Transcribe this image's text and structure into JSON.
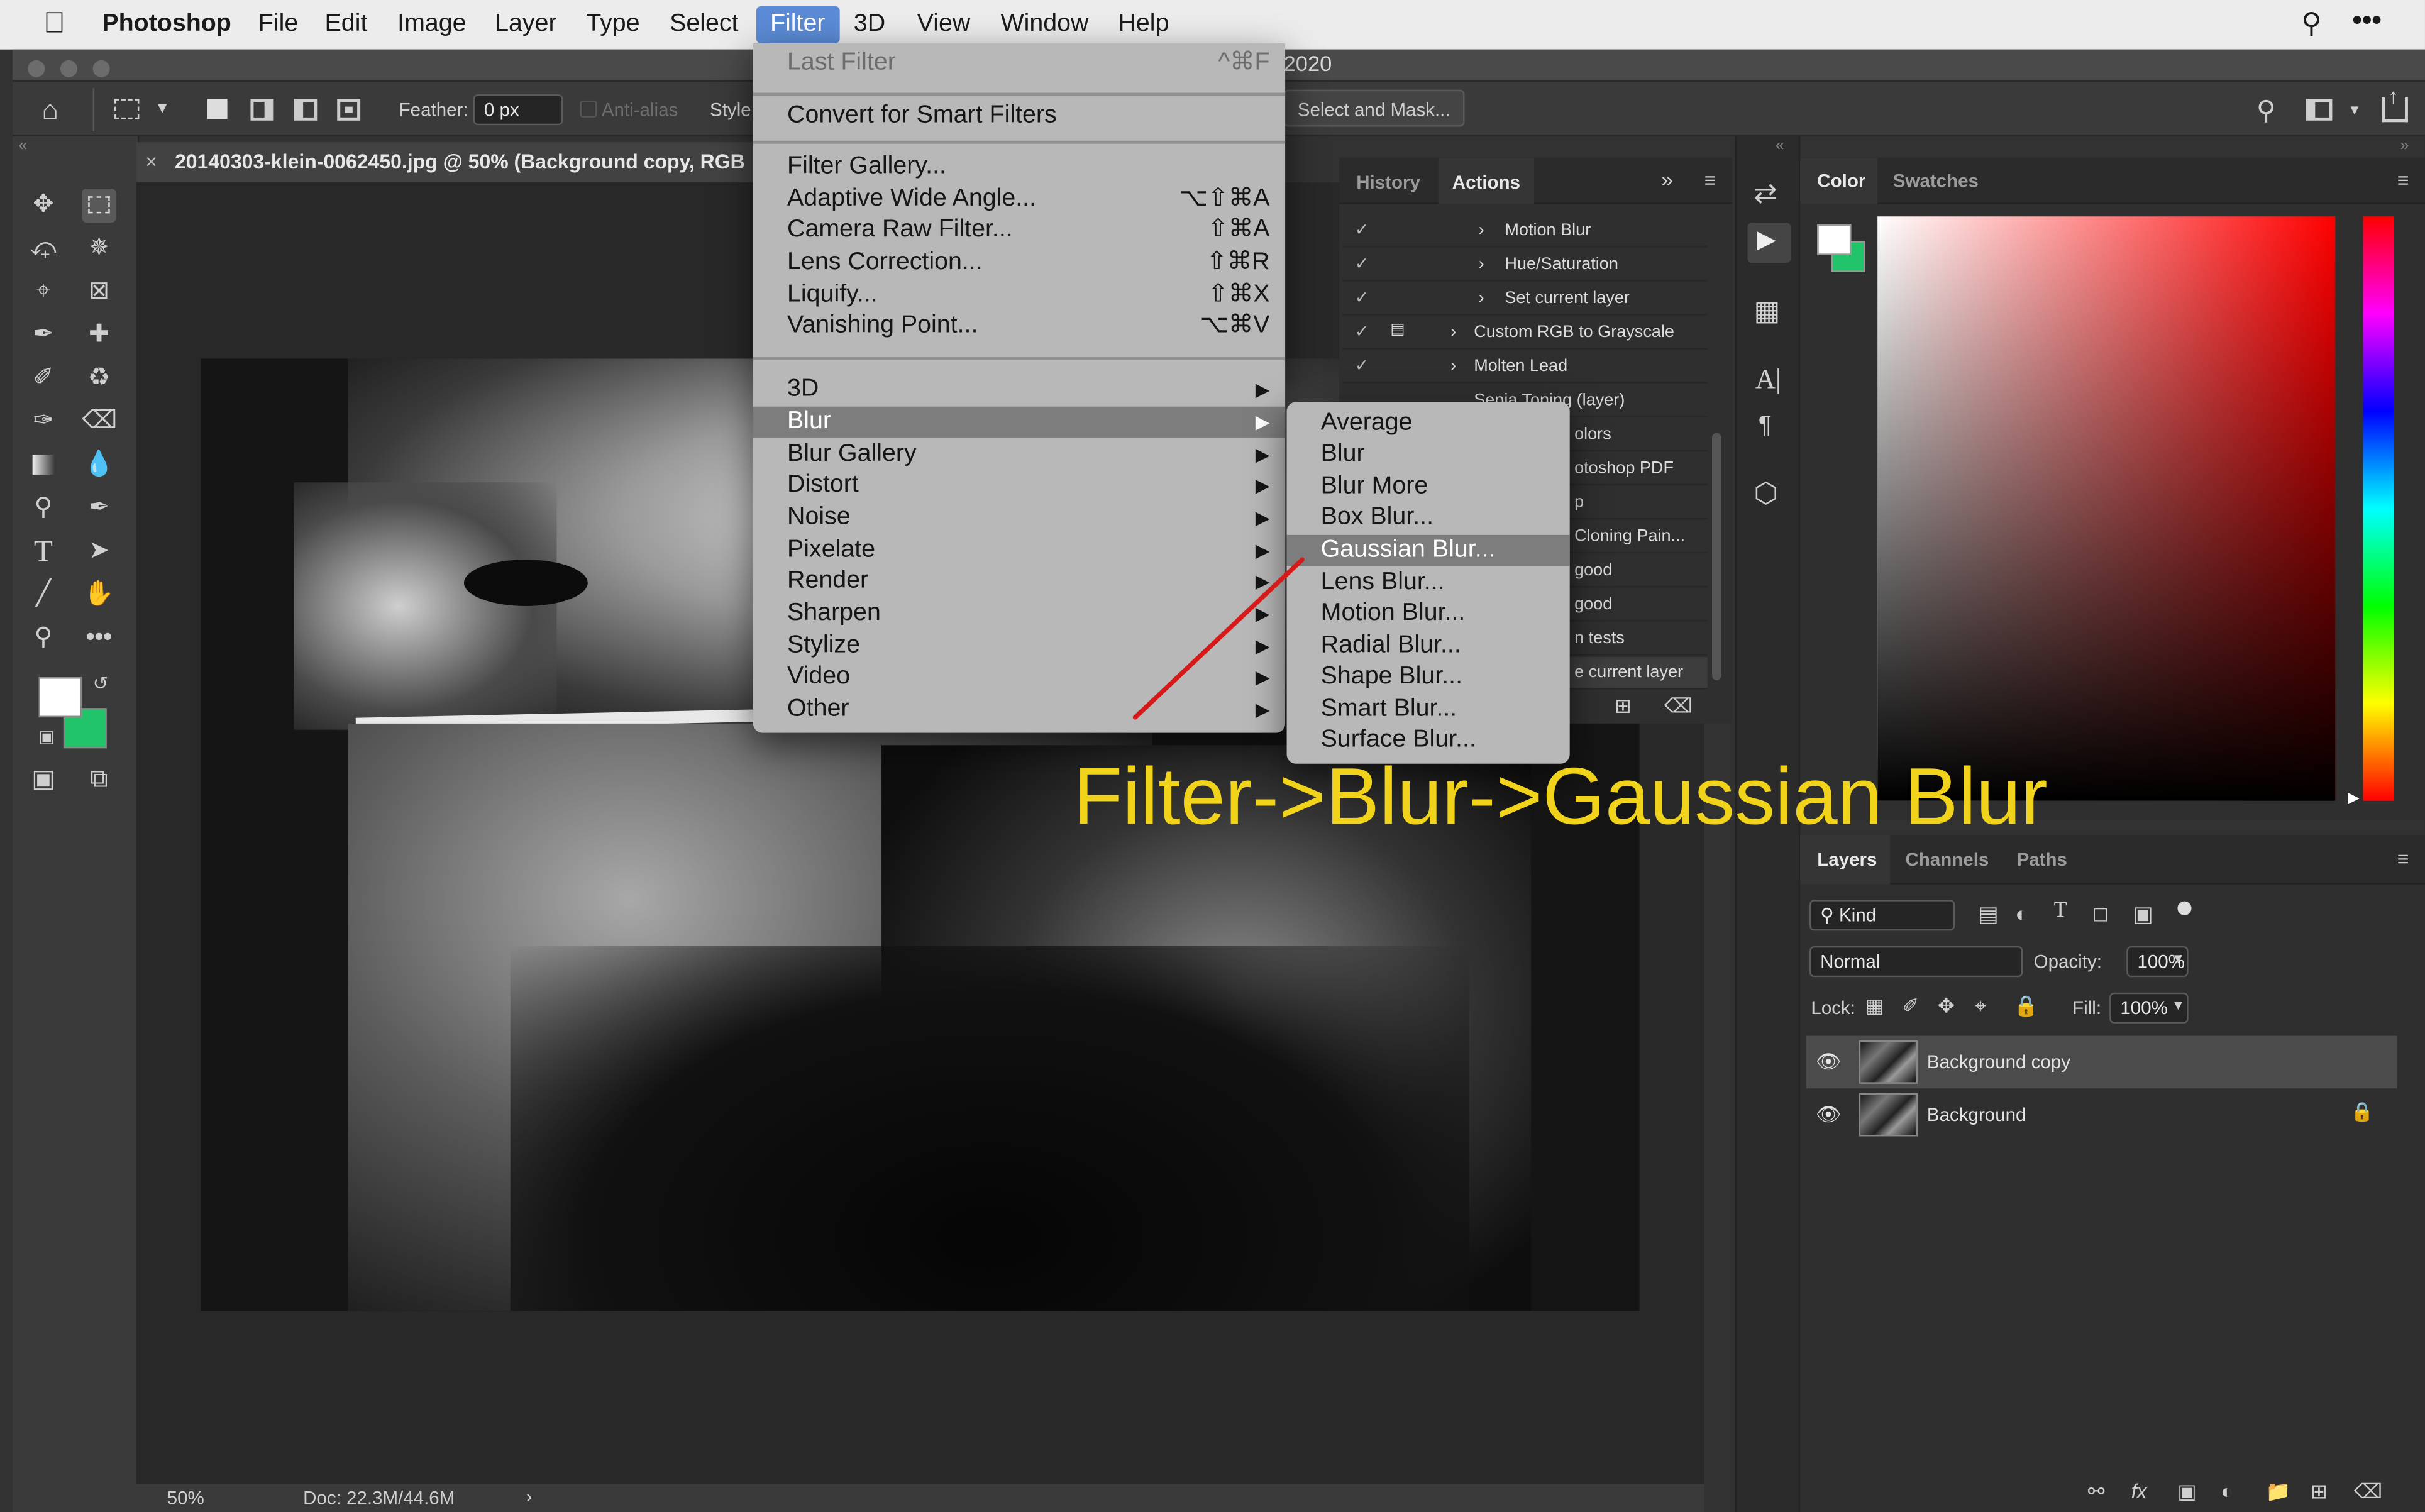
{
  "menubar": {
    "app_name": "Photoshop",
    "items": [
      "File",
      "Edit",
      "Image",
      "Layer",
      "Type",
      "Select",
      "Filter",
      "3D",
      "View",
      "Window",
      "Help"
    ],
    "active": "Filter"
  },
  "window": {
    "title_suffix": "2020"
  },
  "options_bar": {
    "feather_label": "Feather:",
    "feather_value": "0 px",
    "anti_alias_label": "Anti-alias",
    "style_label": "Style:",
    "select_mask_button": "Select and Mask..."
  },
  "document": {
    "tab_title": "20140303-klein-0062450.jpg @ 50% (Background copy, RGB",
    "zoom": "50%",
    "doc_size": "Doc: 22.3M/44.6M"
  },
  "filter_menu": {
    "last_filter": {
      "label": "Last Filter",
      "shortcut": "^⌘F"
    },
    "convert": "Convert for Smart Filters",
    "group1": [
      {
        "label": "Filter Gallery...",
        "shortcut": ""
      },
      {
        "label": "Adaptive Wide Angle...",
        "shortcut": "⌥⇧⌘A"
      },
      {
        "label": "Camera Raw Filter...",
        "shortcut": "⇧⌘A"
      },
      {
        "label": "Lens Correction...",
        "shortcut": "⇧⌘R"
      },
      {
        "label": "Liquify...",
        "shortcut": "⇧⌘X"
      },
      {
        "label": "Vanishing Point...",
        "shortcut": "⌥⌘V"
      }
    ],
    "submenus": [
      "3D",
      "Blur",
      "Blur Gallery",
      "Distort",
      "Noise",
      "Pixelate",
      "Render",
      "Sharpen",
      "Stylize",
      "Video",
      "Other"
    ],
    "highlighted": "Blur"
  },
  "blur_submenu": {
    "items": [
      "Average",
      "Blur",
      "Blur More",
      "Box Blur...",
      "Gaussian Blur...",
      "Lens Blur...",
      "Motion Blur...",
      "Radial Blur...",
      "Shape Blur...",
      "Smart Blur...",
      "Surface Blur..."
    ],
    "highlighted": "Gaussian Blur..."
  },
  "annotation": "Filter->Blur->Gaussian Blur",
  "actions_panel": {
    "tabs": [
      "History",
      "Actions"
    ],
    "active_tab": "Actions",
    "rows": [
      "Motion Blur",
      "Hue/Saturation",
      "Set current layer",
      "Custom RGB to Grayscale",
      "Molten Lead",
      "Sepia Toning (layer)",
      "olors",
      "otoshop PDF",
      "p",
      "Cloning Pain...",
      "good",
      "good",
      "n tests",
      "e current layer"
    ]
  },
  "color_panel": {
    "tabs": [
      "Color",
      "Swatches"
    ],
    "active_tab": "Color"
  },
  "layers_panel": {
    "tabs": [
      "Layers",
      "Channels",
      "Paths"
    ],
    "active_tab": "Layers",
    "kind": "Kind",
    "blend_mode": "Normal",
    "opacity_label": "Opacity:",
    "opacity": "100%",
    "lock_label": "Lock:",
    "fill_label": "Fill:",
    "fill": "100%",
    "layers": [
      {
        "name": "Background copy",
        "selected": true,
        "locked": false
      },
      {
        "name": "Background",
        "selected": false,
        "locked": true
      }
    ]
  },
  "colors": {
    "accent": "#5b8bd6",
    "annotation": "#f2d31b",
    "foreground": "#ffffff",
    "background": "#22c46a"
  }
}
